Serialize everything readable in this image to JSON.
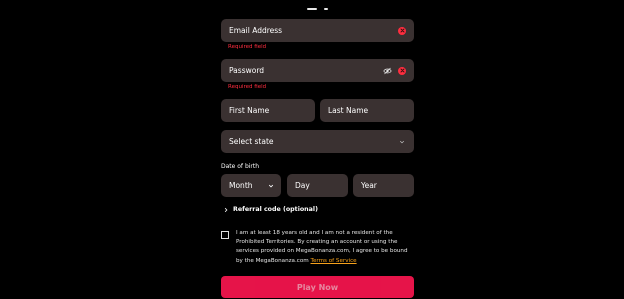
{
  "form": {
    "email": {
      "placeholder": "Email Address",
      "error": "Required field"
    },
    "password": {
      "placeholder": "Password",
      "error": "Required field"
    },
    "first_name": {
      "placeholder": "First Name"
    },
    "last_name": {
      "placeholder": "Last Name"
    },
    "state": {
      "selected": "Select state"
    },
    "dob": {
      "label": "Date of birth",
      "month": "Month",
      "day": "Day",
      "year": "Year"
    },
    "referral": {
      "label": "Referral code (optional)"
    },
    "terms": {
      "text": "I am at least 18 years old and I am not a resident of the Prohibited Territories. By creating an account or using the services provided on MegaBonanza.com, I agree to be bound by the MegaBonanza.com ",
      "link": "Terms of Service",
      "checked": false
    },
    "submit": {
      "label": "Play Now"
    }
  },
  "icons": {
    "error": "error-icon",
    "eye": "eye-slash-icon",
    "chevron": "chevron-down-icon",
    "chevron_right": "chevron-right-icon"
  },
  "colors": {
    "background": "#000000",
    "field": "#3a3131",
    "error": "#ff2d3f",
    "button": "#ff1651",
    "link": "#f7a21b"
  }
}
